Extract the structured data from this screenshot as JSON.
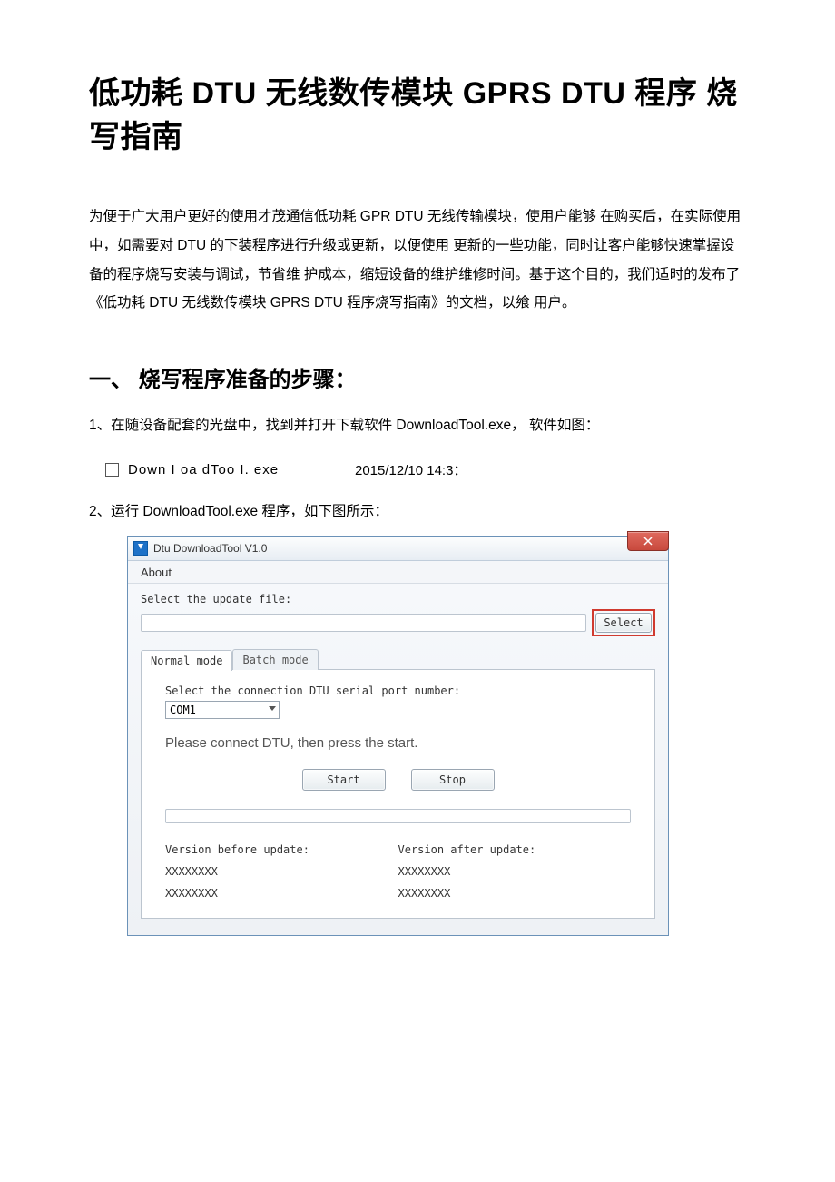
{
  "doc": {
    "title": "低功耗 DTU 无线数传模块 GPRS DTU 程序 烧写指南",
    "intro": "为便于广大用户更好的使用才茂通信低功耗 GPR DTU 无线传输模块，使用户能够 在购买后，在实际使用中，如需要对 DTU 的下装程序进行升级或更新，以便使用 更新的一些功能，同时让客户能够快速掌握设备的程序烧写安装与调试，节省维 护成本，缩短设备的维护维修时间。基于这个目的，我们适时的发布了《低功耗 DTU 无线数传模块 GPRS DTU 程序烧写指南》的文档，以飨 用户。",
    "section1": "一、 烧写程序准备的步骤：",
    "step1": "1、在随设备配套的光盘中，找到并打开下载软件 DownloadTool.exe， 软件如图：",
    "file": {
      "name": "Down I oa dToo I. exe",
      "date": "2015/12/10 14:3："
    },
    "step2": "2、运行 DownloadTool.exe 程序，如下图所示："
  },
  "tool": {
    "window_title": "Dtu DownloadTool V1.0",
    "menu_about": "About",
    "select_file_label": "Select the update file:",
    "select_btn": "Select",
    "tab_normal": "Normal mode",
    "tab_batch": "Batch mode",
    "serial_label": "Select the connection DTU serial port number:",
    "com_value": "COM1",
    "status": "Please connect DTU, then press the start.",
    "start_btn": "Start",
    "stop_btn": "Stop",
    "ver_before_label": "Version before update:",
    "ver_after_label": "Version after update:",
    "ver_before_1": "XXXXXXXX",
    "ver_before_2": "XXXXXXXX",
    "ver_after_1": "XXXXXXXX",
    "ver_after_2": "XXXXXXXX"
  }
}
